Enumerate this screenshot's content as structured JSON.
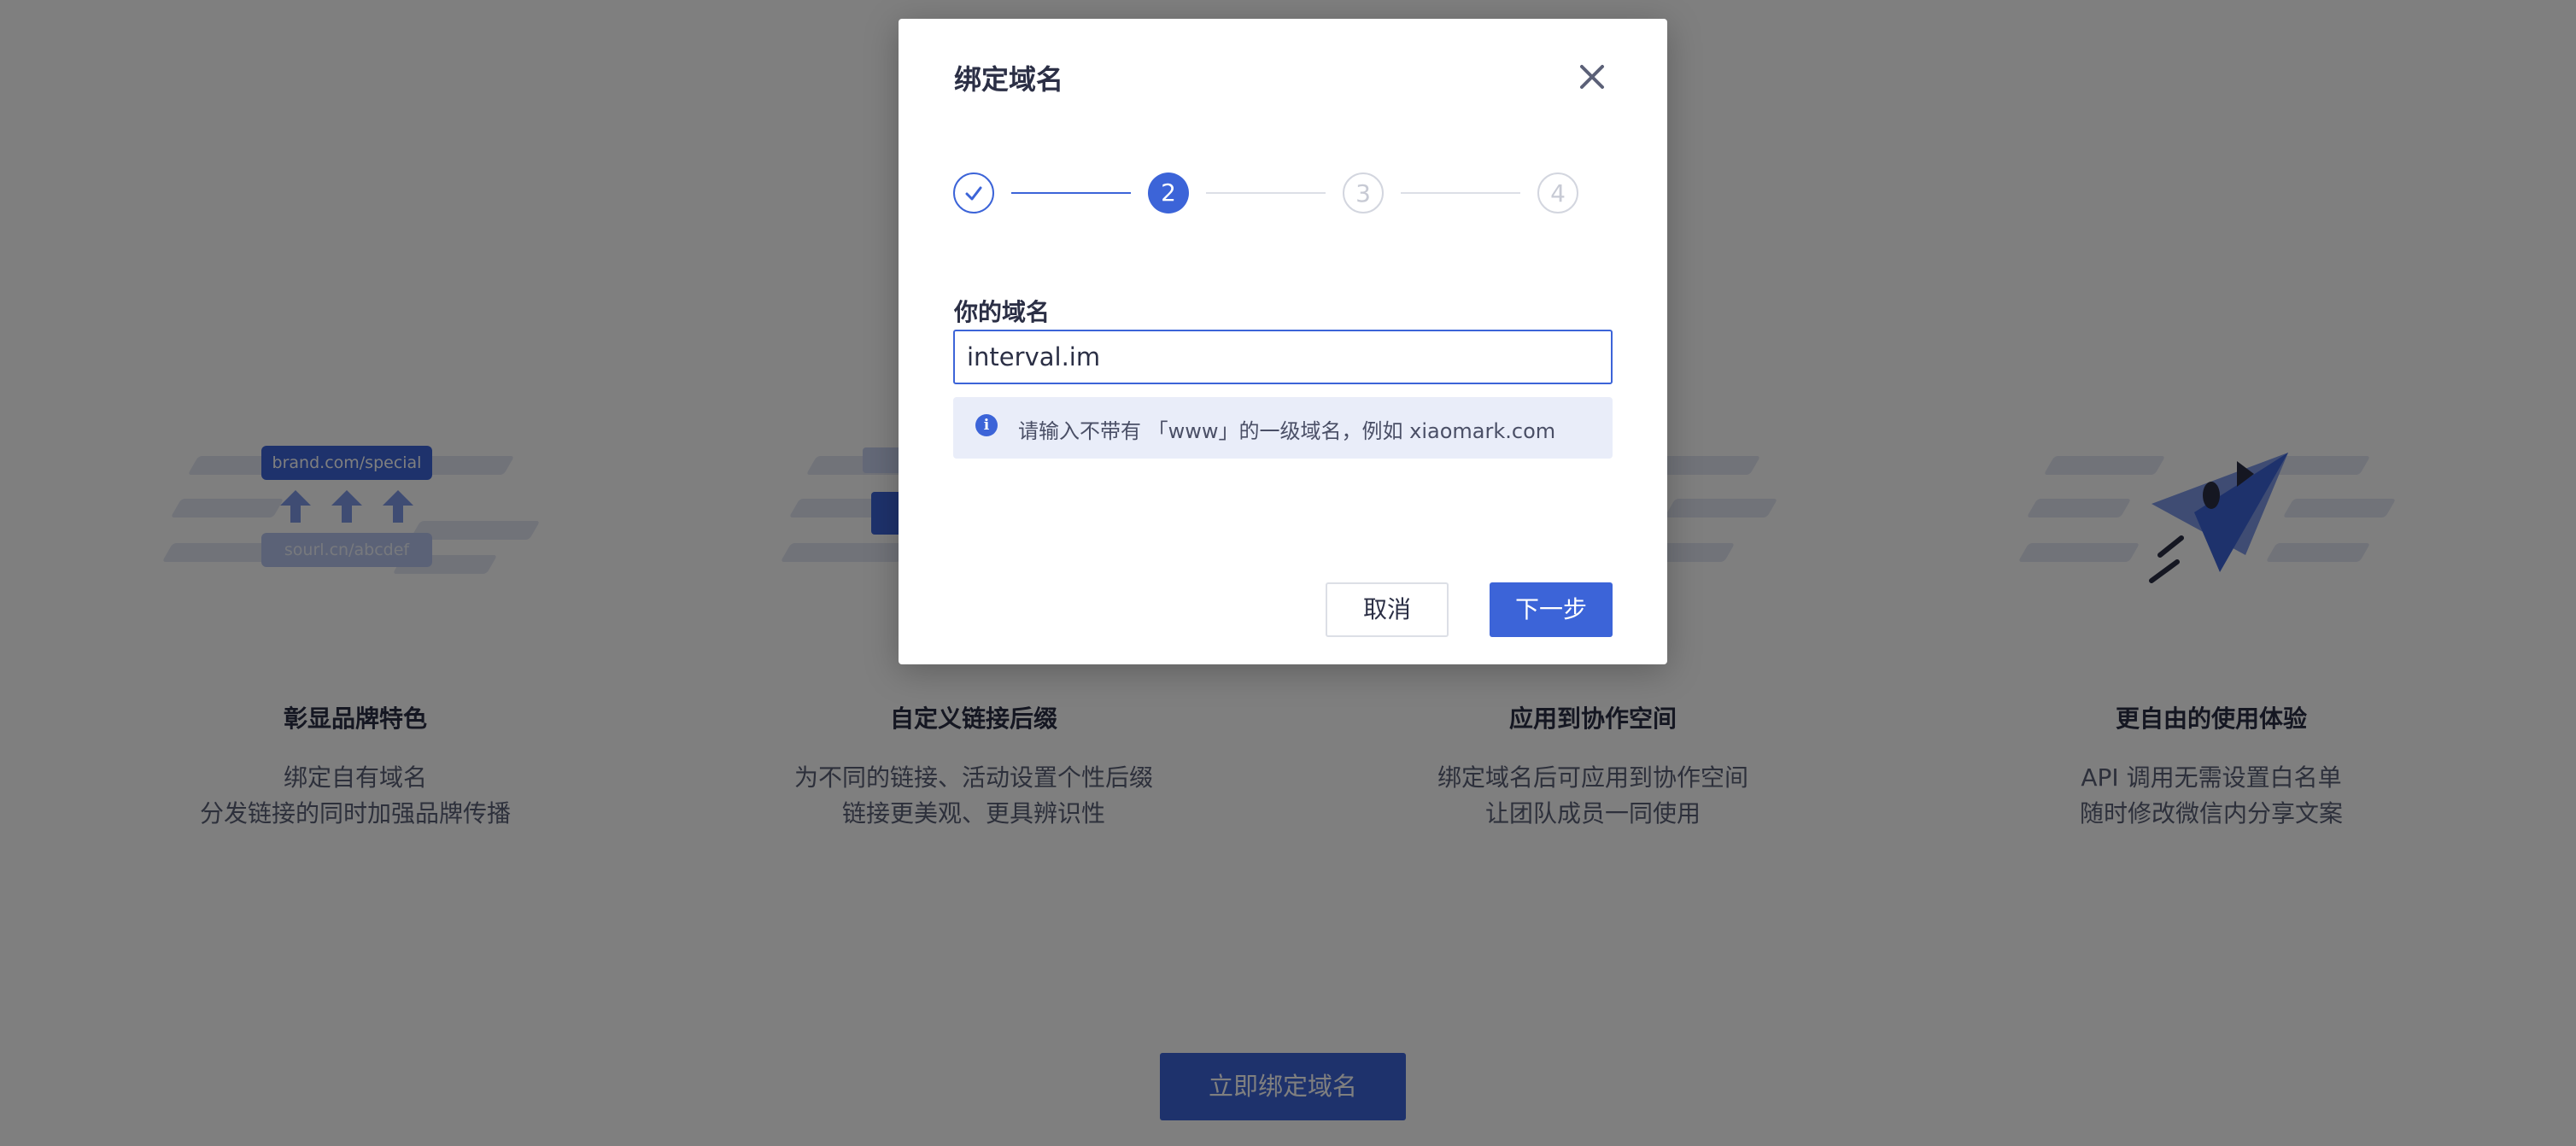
{
  "features": [
    {
      "title": "彰显品牌特色",
      "lines": [
        "绑定自有域名",
        "分发链接的同时加强品牌传播"
      ],
      "tags": [
        "brand.com/special",
        "sourl.cn/abcdef"
      ]
    },
    {
      "title": "自定义链接后缀",
      "lines": [
        "为不同的链接、活动设置个性后缀",
        "链接更美观、更具辨识性"
      ]
    },
    {
      "title": "应用到协作空间",
      "lines": [
        "绑定域名后可应用到协作空间",
        "让团队成员一同使用"
      ]
    },
    {
      "title": "更自由的使用体验",
      "lines": [
        "API 调用无需设置白名单",
        "随时修改微信内分享文案"
      ]
    }
  ],
  "cta_label": "立即绑定域名",
  "modal": {
    "title": "绑定域名",
    "close_icon": "close-icon",
    "steps": [
      {
        "label": "",
        "state": "done"
      },
      {
        "label": "2",
        "state": "active"
      },
      {
        "label": "3",
        "state": "todo"
      },
      {
        "label": "4",
        "state": "todo"
      }
    ],
    "field_label": "你的域名",
    "domain_value": "interval.im",
    "hint_icon_glyph": "i",
    "hint_text": "请输入不带有 「www」的一级域名，例如 xiaomark.com",
    "cancel_label": "取消",
    "next_label": "下一步"
  },
  "colors": {
    "primary": "#3c64d8",
    "hint_bg": "#e9edf9",
    "text": "#2b2f45"
  }
}
